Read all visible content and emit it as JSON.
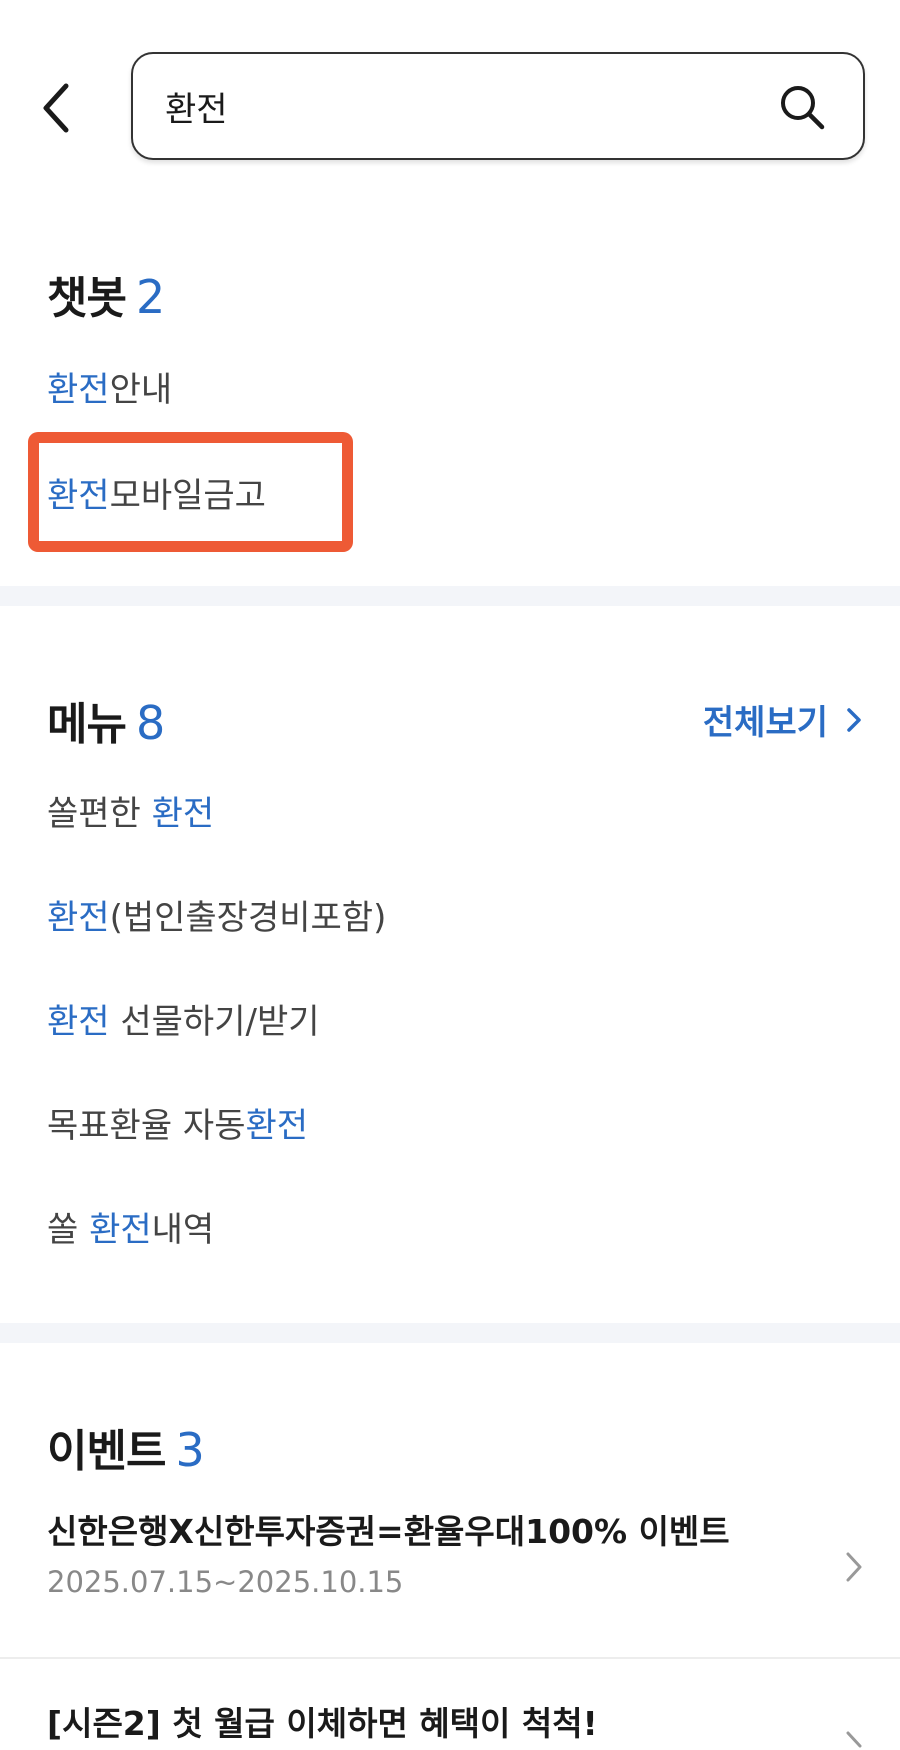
{
  "search": {
    "value": "환전",
    "placeholder": ""
  },
  "chatbot": {
    "title": "챗봇",
    "count": "2",
    "items": [
      {
        "hl": "환전",
        "rest": "안내"
      },
      {
        "hl": "환전",
        "rest": "모바일금고"
      }
    ]
  },
  "menu": {
    "title": "메뉴",
    "count": "8",
    "see_all": "전체보기",
    "items": [
      {
        "pre": "쏠편한 ",
        "hl": "환전",
        "post": ""
      },
      {
        "pre": "",
        "hl": "환전",
        "post": "(법인출장경비포함)"
      },
      {
        "pre": "",
        "hl": "환전",
        "post": " 선물하기/받기"
      },
      {
        "pre": "목표환율 자동",
        "hl": "환전",
        "post": ""
      },
      {
        "pre": "쏠 ",
        "hl": "환전",
        "post": "내역"
      }
    ]
  },
  "events": {
    "title": "이벤트",
    "count": "3",
    "items": [
      {
        "title": "신한은행X신한투자증권=환율우대100% 이벤트",
        "date": "2025.07.15~2025.10.15"
      },
      {
        "title": "[시즌2] 첫 월급 이체하면 혜택이 척척!",
        "date": ""
      }
    ]
  },
  "colors": {
    "accent": "#2a6cc4",
    "highlight_border": "#ee5a35",
    "divider": "#f3f5f9"
  },
  "icons": {
    "back": "chevron-left-icon",
    "search": "search-icon",
    "row_arrow": "chevron-right-icon"
  }
}
